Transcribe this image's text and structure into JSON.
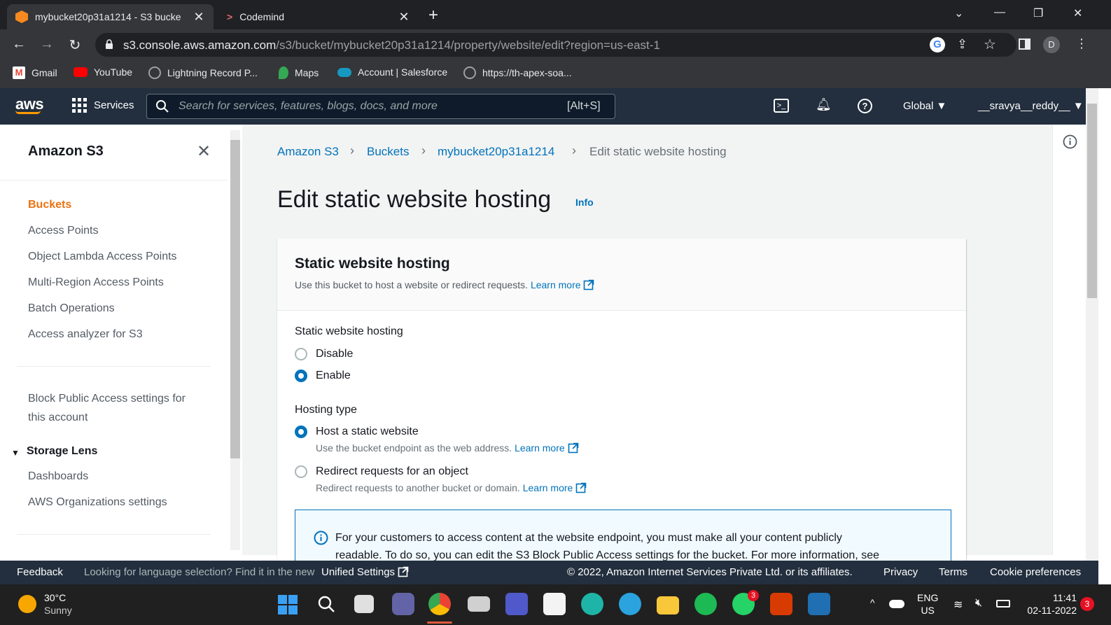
{
  "browser": {
    "tabs": [
      {
        "title": "mybucket20p31a1214 - S3 bucke",
        "active": true
      },
      {
        "title": "Codemind",
        "active": false
      }
    ],
    "url_host": "s3.console.aws.amazon.com",
    "url_path": "/s3/bucket/mybucket20p31a1214/property/website/edit?region=us-east-1",
    "profile_initial": "D",
    "bookmarks": [
      "Gmail",
      "YouTube",
      "Lightning Record P...",
      "Maps",
      "Account | Salesforce",
      "https://th-apex-soa..."
    ]
  },
  "aws_nav": {
    "logo": "aws",
    "services_label": "Services",
    "search_placeholder": "Search for services, features, blogs, docs, and more",
    "search_shortcut": "[Alt+S]",
    "region": "Global ▼",
    "user": "__sravya__reddy__ ▼"
  },
  "sidebar": {
    "title": "Amazon S3",
    "items": [
      {
        "label": "Buckets",
        "active": true
      },
      {
        "label": "Access Points"
      },
      {
        "label": "Object Lambda Access Points"
      },
      {
        "label": "Multi-Region Access Points"
      },
      {
        "label": "Batch Operations"
      },
      {
        "label": "Access analyzer for S3"
      }
    ],
    "block_public_line1": "Block Public Access settings for",
    "block_public_line2": "this account",
    "storage_lens_label": "Storage Lens",
    "storage_lens_items": [
      "Dashboards",
      "AWS Organizations settings"
    ]
  },
  "breadcrumb": [
    "Amazon S3",
    "Buckets",
    "mybucket20p31a1214",
    "Edit static website hosting"
  ],
  "page": {
    "title": "Edit static website hosting",
    "info_link": "Info"
  },
  "panel": {
    "title": "Static website hosting",
    "description": "Use this bucket to host a website or redirect requests.",
    "learn_more": "Learn more",
    "hosting_label": "Static website hosting",
    "hosting_options": [
      {
        "label": "Disable",
        "selected": false
      },
      {
        "label": "Enable",
        "selected": true
      }
    ],
    "hosting_type_label": "Hosting type",
    "hosting_types": [
      {
        "label": "Host a static website",
        "desc": "Use the bucket endpoint as the web address.",
        "selected": true
      },
      {
        "label": "Redirect requests for an object",
        "desc": "Redirect requests to another bucket or domain.",
        "selected": false
      }
    ],
    "alert_line1": "For your customers to access content at the website endpoint, you must make all your content publicly",
    "alert_line2": "readable. To do so, you can edit the S3 Block Public Access settings for the bucket. For more information, see"
  },
  "footer": {
    "feedback": "Feedback",
    "lang_text": "Looking for language selection? Find it in the new",
    "unified_settings": "Unified Settings",
    "copyright": "© 2022, Amazon Internet Services Private Ltd. or its affiliates.",
    "privacy": "Privacy",
    "terms": "Terms",
    "cookie": "Cookie preferences"
  },
  "taskbar": {
    "temp": "30°C",
    "condition": "Sunny",
    "lang1": "ENG",
    "lang2": "US",
    "time": "11:41",
    "date": "02-11-2022",
    "notif_count": "3",
    "whatsapp_badge": "3"
  },
  "colors": {
    "aws_nav": "#232f3e",
    "link": "#0073bb",
    "active_nav": "#ec7211"
  }
}
